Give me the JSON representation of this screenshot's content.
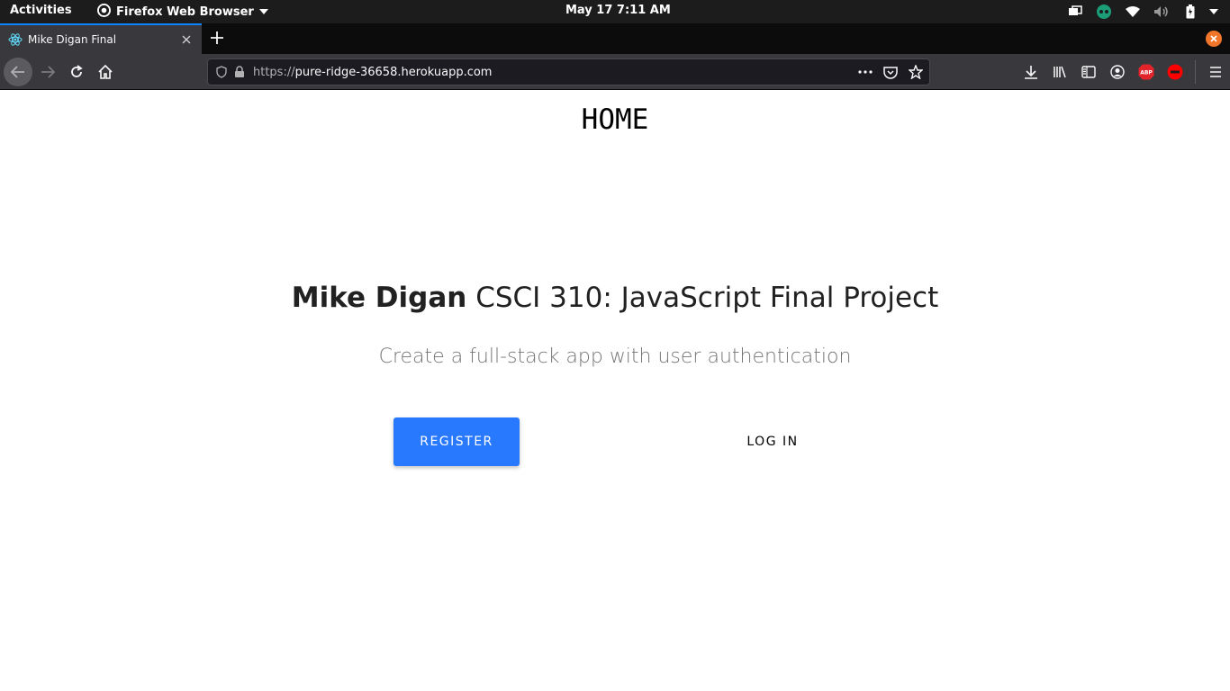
{
  "system_bar": {
    "activities": "Activities",
    "app_name": "Firefox Web Browser",
    "clock": "May 17   7:11 AM"
  },
  "browser": {
    "tab_title": "Mike Digan Final",
    "url_scheme": "https://",
    "url_host": "pure-ridge-36658.herokuapp.com"
  },
  "page": {
    "nav_title": "HOME",
    "author": "Mike Digan",
    "headline_rest": " CSCI 310: JavaScript Final Project",
    "subtitle": "Create a full-stack app with user authentication",
    "register_label": "REGISTER",
    "login_label": "LOG IN"
  },
  "colors": {
    "accent": "#2979ff",
    "tab_highlight": "#0a84ff",
    "close_orange": "#f1762a"
  },
  "icons": {
    "system_tray": [
      "screen-icon",
      "chat-icon",
      "wifi-icon",
      "volume-icon",
      "battery-icon"
    ],
    "toolbar": [
      "download-icon",
      "library-icon",
      "sidebar-icon",
      "account-icon",
      "adblock-icon",
      "block-icon",
      "menu-icon"
    ]
  }
}
